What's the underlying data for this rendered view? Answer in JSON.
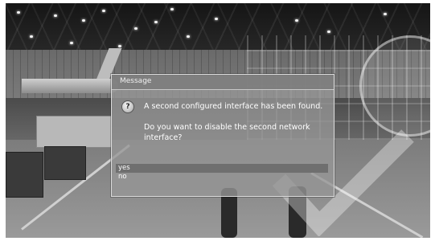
{
  "dialog": {
    "title": "Message",
    "icon": "help-icon",
    "line1": "A second configured interface has been found.",
    "line2": "Do you want to disable the second network interface?",
    "options": [
      {
        "label": "yes",
        "selected": true
      },
      {
        "label": "no",
        "selected": false
      }
    ]
  },
  "colors": {
    "selected_row": "#6f6f6f",
    "dialog_bg": "#969696",
    "text": "#ffffff"
  }
}
